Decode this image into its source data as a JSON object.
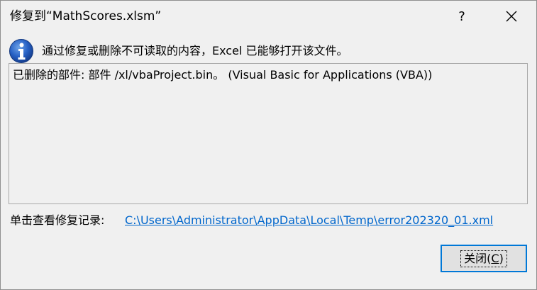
{
  "dialog": {
    "title": "修复到“MathScores.xlsm”",
    "help_label": "?",
    "message": "通过修复或删除不可读取的内容，Excel 已能够打开该文件。",
    "details": "已删除的部件: 部件 /xl/vbaProject.bin。 (Visual Basic for Applications (VBA))",
    "log_label": "单击查看修复记录:",
    "log_link": "C:\\Users\\Administrator\\AppData\\Local\\Temp\\error202320_01.xml",
    "ok_label_prefix": "关闭(",
    "ok_label_mnemonic": "C",
    "ok_label_suffix": ")",
    "icons": {
      "info": "info-icon",
      "close": "close-icon"
    },
    "colors": {
      "link": "#0066cc",
      "focus_border": "#0078d7"
    }
  }
}
